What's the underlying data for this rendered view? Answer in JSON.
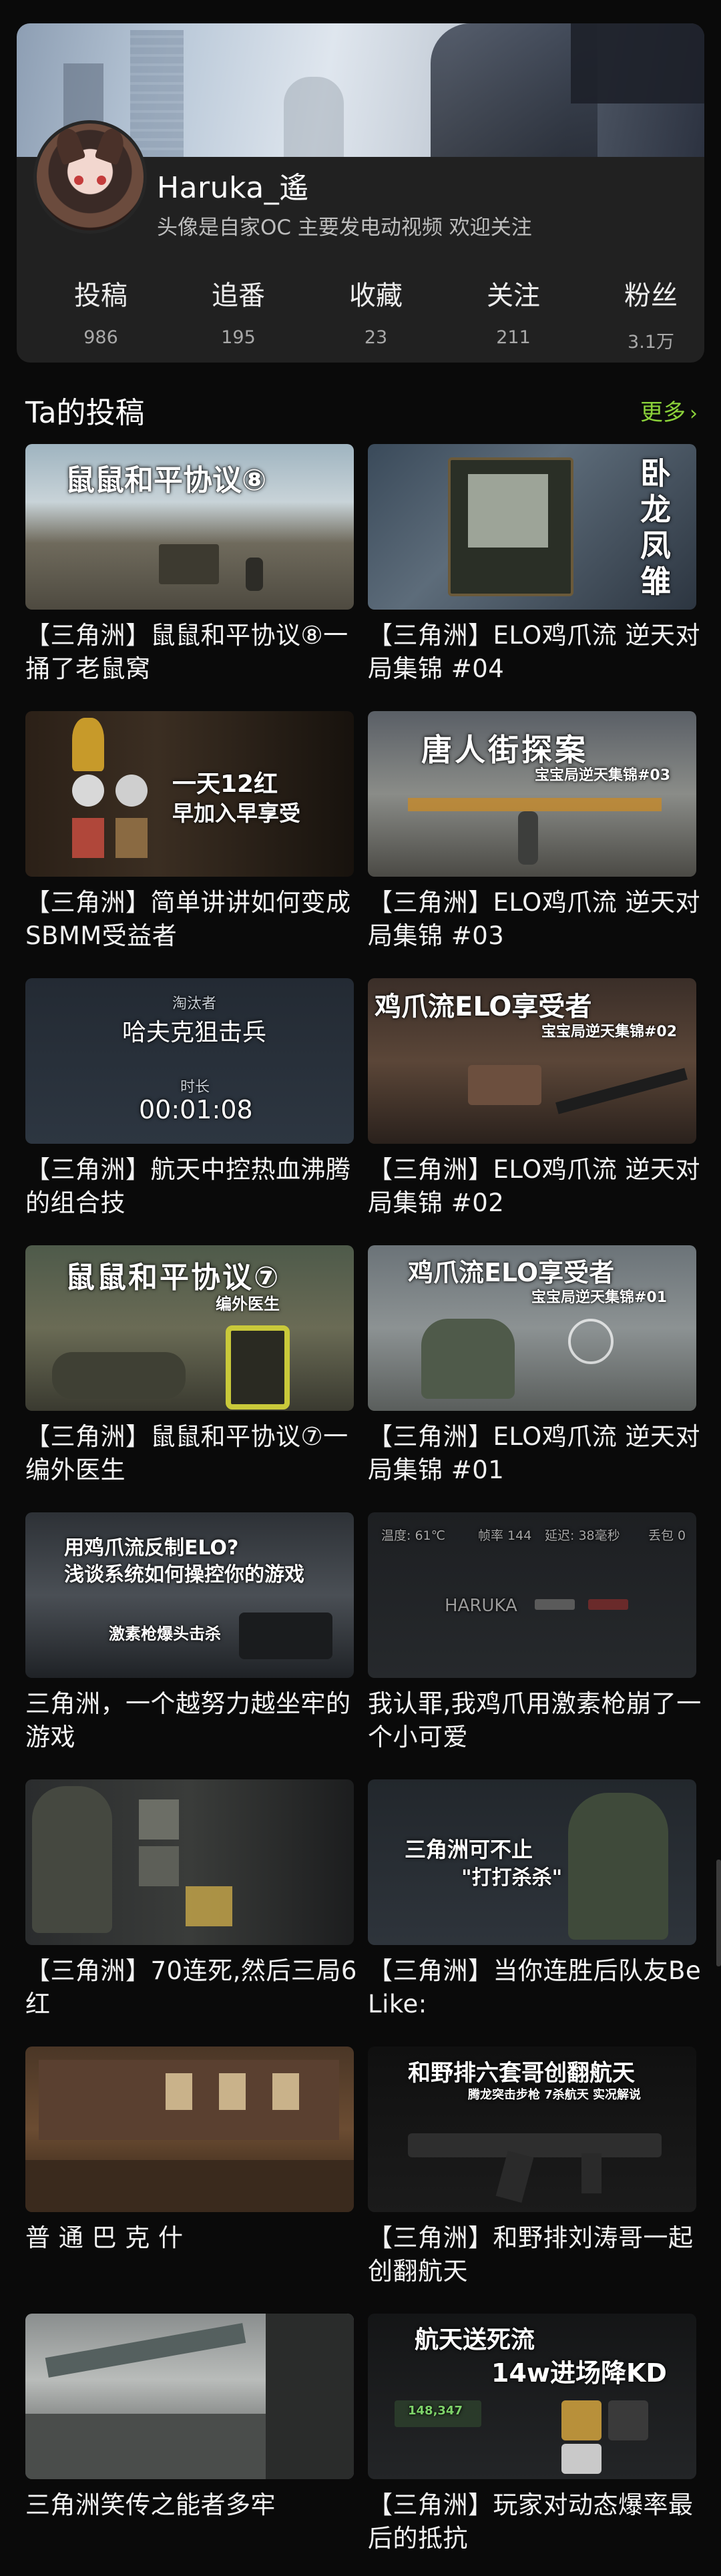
{
  "profile": {
    "username": "Haruka_遙",
    "bio": "头像是自家OC 主要发电动视频 欢迎关注",
    "stats": [
      {
        "label": "投稿",
        "value": "986"
      },
      {
        "label": "追番",
        "value": "195"
      },
      {
        "label": "收藏",
        "value": "23"
      },
      {
        "label": "关注",
        "value": "211"
      },
      {
        "label": "粉丝",
        "value": "3.1万"
      }
    ]
  },
  "section": {
    "title": "Ta的投稿",
    "more": "更多",
    "more_icon": "chevron-right-icon"
  },
  "videos": [
    {
      "title": "【三角洲】鼠鼠和平协议⑧一捅了老鼠窝",
      "overlay": [
        "鼠鼠和平协议⑧"
      ]
    },
    {
      "title": "【三角洲】ELO鸡爪流 逆天对局集锦 #04",
      "overlay": [
        "卧",
        "龙",
        "凤",
        "雏"
      ]
    },
    {
      "title": "【三角洲】简单讲讲如何变成SBMM受益者",
      "overlay": [
        "一天12红",
        "早加入早享受"
      ]
    },
    {
      "title": "【三角洲】ELO鸡爪流 逆天对局集锦 #03",
      "overlay": [
        "唐人街探案",
        "宝宝局逆天集锦#03"
      ]
    },
    {
      "title": "【三角洲】航天中控热血沸腾的组合技",
      "overlay": [
        "淘汰者",
        "哈夫克狙击兵",
        "时长",
        "00:01:08"
      ]
    },
    {
      "title": "【三角洲】ELO鸡爪流 逆天对局集锦 #02",
      "overlay": [
        "鸡爪流ELO享受者",
        "宝宝局逆天集锦#02"
      ]
    },
    {
      "title": "【三角洲】鼠鼠和平协议⑦一编外医生",
      "overlay": [
        "鼠鼠和平协议⑦",
        "编外医生"
      ]
    },
    {
      "title": "【三角洲】ELO鸡爪流 逆天对局集锦 #01",
      "overlay": [
        "鸡爪流ELO享受者",
        "宝宝局逆天集锦#01"
      ]
    },
    {
      "title": "三角洲，一个越努力越坐牢的游戏",
      "overlay": [
        "用鸡爪流反制ELO?",
        "浅谈系统如何操控你的游戏",
        "激素枪爆头击杀"
      ]
    },
    {
      "title": "我认罪,我鸡爪用激素枪崩了一个小可爱",
      "overlay": [
        "温度: 61℃",
        "帧率 144",
        "延迟: 38毫秒",
        "丢包 0",
        "HARUKA"
      ]
    },
    {
      "title": "【三角洲】70连死,然后三局6红",
      "overlay": []
    },
    {
      "title": "【三角洲】当你连胜后队友Be Like:",
      "overlay": [
        "三角洲可不止",
        "\"打打杀杀\""
      ]
    },
    {
      "title": "普 通 巴 克 什",
      "overlay": []
    },
    {
      "title": "【三角洲】和野排刘涛哥一起创翻航天",
      "overlay": [
        "和野排六套哥创翻航天",
        "腾龙突击步枪 7杀航天 实况解说"
      ]
    },
    {
      "title": "三角洲笑传之能者多牢",
      "overlay": []
    },
    {
      "title": "【三角洲】玩家对动态爆率最后的抵抗",
      "overlay": [
        "航天送死流",
        "14w进场降KD",
        "148,347"
      ]
    }
  ]
}
